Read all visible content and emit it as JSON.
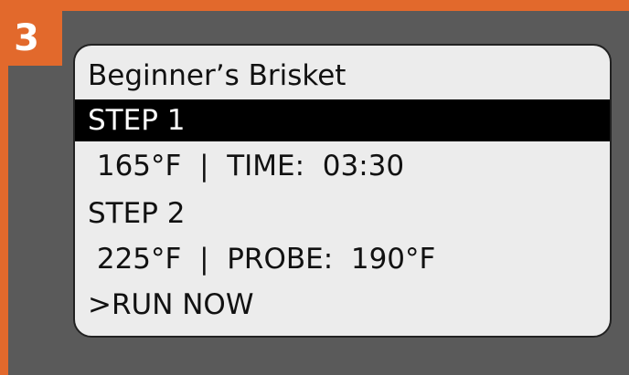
{
  "badge": {
    "number": "3"
  },
  "display": {
    "title": "Beginner’s Brisket",
    "step1_label": "STEP 1",
    "step1_detail": " 165°F  |  TIME:  03:30",
    "step2_label": "STEP 2",
    "step2_detail": " 225°F  |  PROBE:  190°F",
    "run_now": ">RUN NOW"
  },
  "colors": {
    "accent_orange": "#e2692c",
    "panel_gray": "#5a5a5a",
    "screen_bg": "#ececec",
    "highlight_bg": "#000000"
  }
}
